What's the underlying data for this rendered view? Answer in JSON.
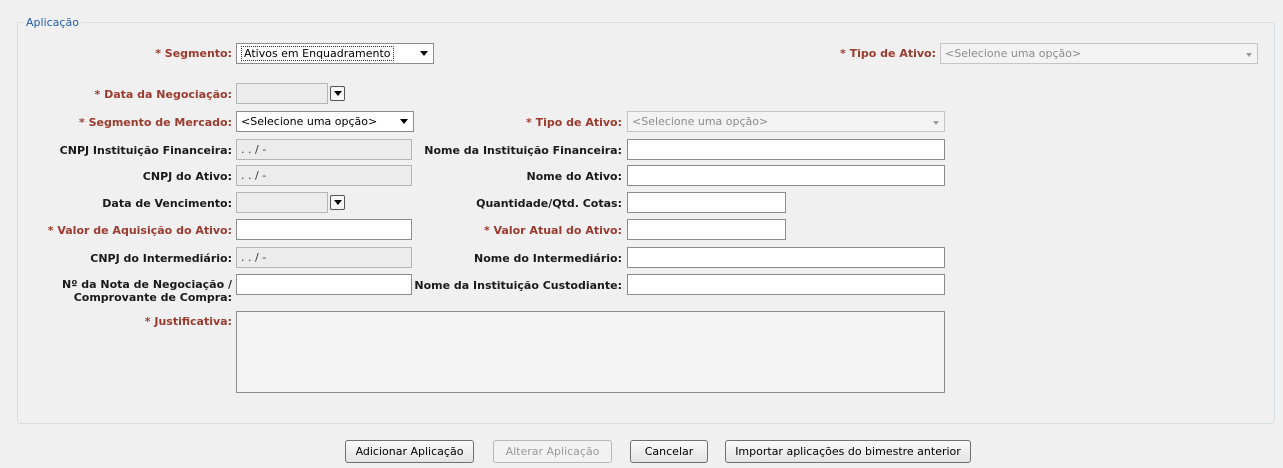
{
  "section": {
    "title": "Aplicação"
  },
  "segmento": {
    "label": "* Segmento:",
    "value": "Ativos em Enquadramento"
  },
  "tipo_ativo_top": {
    "label": "* Tipo de Ativo:",
    "value": "<Selecione uma opção>"
  },
  "data_negociacao": {
    "label": "* Data da Negociação:",
    "value": ""
  },
  "segmento_mercado": {
    "label": "* Segmento de Mercado:",
    "value": "<Selecione uma opção>"
  },
  "tipo_ativo": {
    "label": "* Tipo de Ativo:",
    "value": "<Selecione uma opção>"
  },
  "cnpj_instituicao": {
    "label": "CNPJ Instituição Financeira:",
    "value": ". . / -"
  },
  "nome_instituicao": {
    "label": "Nome da Instituição Financeira:",
    "value": ""
  },
  "cnpj_ativo": {
    "label": "CNPJ do Ativo:",
    "value": ". . / -"
  },
  "nome_ativo": {
    "label": "Nome do Ativo:",
    "value": ""
  },
  "data_vencimento": {
    "label": "Data de Vencimento:",
    "value": ""
  },
  "quantidade": {
    "label": "Quantidade/Qtd. Cotas:",
    "value": ""
  },
  "valor_aquisicao": {
    "label": "* Valor de Aquisição do Ativo:",
    "value": ""
  },
  "valor_atual": {
    "label": "* Valor Atual do Ativo:",
    "value": ""
  },
  "cnpj_intermediario": {
    "label": "CNPJ do Intermediário:",
    "value": ". . / -"
  },
  "nome_intermediario": {
    "label": "Nome do Intermediário:",
    "value": ""
  },
  "nota_negociacao": {
    "label": "Nº da Nota de Negociação / Comprovante de Compra:",
    "value": ""
  },
  "nome_custodiante": {
    "label": "Nome da Instituição Custodiante:",
    "value": ""
  },
  "justificativa": {
    "label": "* Justificativa:",
    "value": ""
  },
  "buttons": {
    "adicionar": "Adicionar Aplicação",
    "alterar": "Alterar Aplicação",
    "cancelar": "Cancelar",
    "importar": "Importar aplicações do bimestre anterior"
  },
  "colors": {
    "required_label": "#9b3a2e",
    "legend": "#1f5fa8"
  }
}
